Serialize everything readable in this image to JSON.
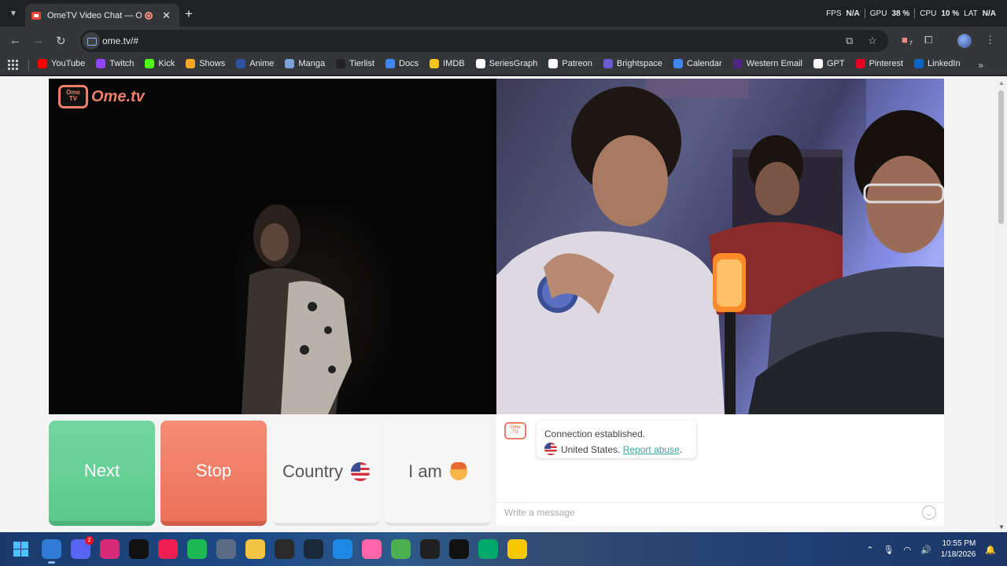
{
  "browser": {
    "tab_title": "OmeTV Video Chat — Ome",
    "new_tab_symbol": "+",
    "url": "ome.tv/#",
    "perf": {
      "fps_label": "FPS",
      "fps_value": "N/A",
      "gpu_label": "GPU",
      "gpu_value": "38 %",
      "cpu_label": "CPU",
      "cpu_value": "10 %",
      "lat_label": "LAT",
      "lat_value": "N/A"
    },
    "extension_badge": "7"
  },
  "bookmarks": [
    {
      "label": "YouTube",
      "color": "#ff0000"
    },
    {
      "label": "Twitch",
      "color": "#9146ff"
    },
    {
      "label": "Kick",
      "color": "#53fc18"
    },
    {
      "label": "Shows",
      "color": "#f5a623"
    },
    {
      "label": "Anime",
      "color": "#2e51a2"
    },
    {
      "label": "Manga",
      "color": "#7aa0d8"
    },
    {
      "label": "Tierlist",
      "color": "#222222"
    },
    {
      "label": "Docs",
      "color": "#4285f4"
    },
    {
      "label": "IMDB",
      "color": "#f5c518"
    },
    {
      "label": "SeriesGraph",
      "color": "#ffffff"
    },
    {
      "label": "Patreon",
      "color": "#ffffff"
    },
    {
      "label": "Brightspace",
      "color": "#6b5bd2"
    },
    {
      "label": "Calendar",
      "color": "#4285f4"
    },
    {
      "label": "Western Email",
      "color": "#4f2683"
    },
    {
      "label": "GPT",
      "color": "#ffffff"
    },
    {
      "label": "Pinterest",
      "color": "#e60023"
    },
    {
      "label": "LinkedIn",
      "color": "#0a66c2"
    }
  ],
  "page": {
    "logo_text": "Ome.tv",
    "logo_badge": "Ome TV",
    "buttons": {
      "next": "Next",
      "stop": "Stop",
      "country": "Country",
      "iam": "I am"
    },
    "chat": {
      "status": "Connection established.",
      "country": "United States.",
      "report": "Report abuse",
      "report_suffix": ".",
      "placeholder": "Write a message"
    }
  },
  "taskbar": {
    "time": "10:55 PM",
    "date": "1/18/2026",
    "discord_badge": "2",
    "apps": [
      {
        "name": "chrome",
        "color": "#2f7bd6"
      },
      {
        "name": "discord",
        "color": "#5865f2"
      },
      {
        "name": "instagram",
        "color": "#d62976"
      },
      {
        "name": "tiktok",
        "color": "#111111"
      },
      {
        "name": "tiktok-alt",
        "color": "#ee1d52"
      },
      {
        "name": "spotify",
        "color": "#1db954"
      },
      {
        "name": "settings",
        "color": "#5b6b86"
      },
      {
        "name": "file-explorer",
        "color": "#f3c343"
      },
      {
        "name": "epic-games",
        "color": "#2a2a2a"
      },
      {
        "name": "steam",
        "color": "#1b2838"
      },
      {
        "name": "app-blue",
        "color": "#1e88e5"
      },
      {
        "name": "osu",
        "color": "#ff66aa"
      },
      {
        "name": "app-colorful",
        "color": "#4caf50"
      },
      {
        "name": "app-mask",
        "color": "#202020"
      },
      {
        "name": "capcut",
        "color": "#111111"
      },
      {
        "name": "app-green",
        "color": "#00a86b"
      },
      {
        "name": "app-yellow",
        "color": "#f9c900"
      }
    ]
  }
}
